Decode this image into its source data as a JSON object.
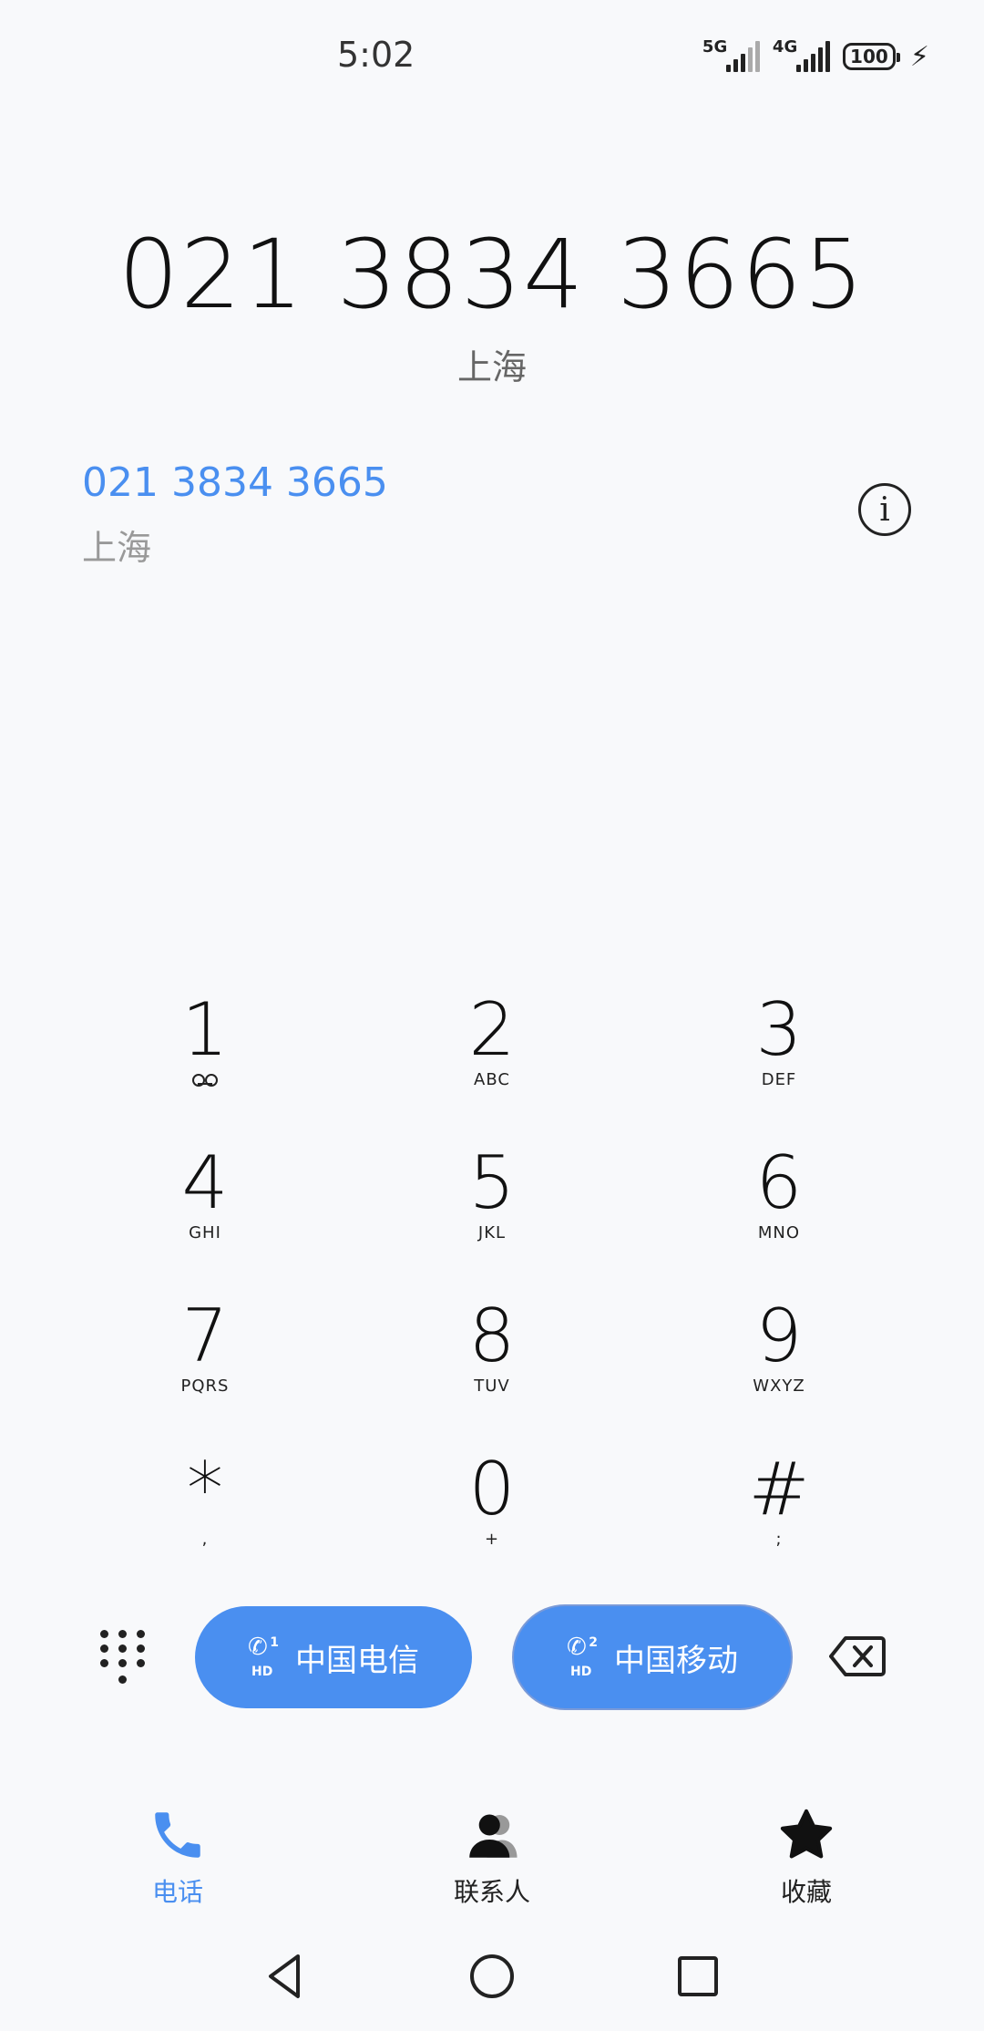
{
  "status_bar": {
    "time": "5:02",
    "sim1_network": "5G",
    "sim2_network": "4G",
    "battery_level": "100",
    "charging_icon": "bolt-icon"
  },
  "dialer": {
    "number": "021 3834 3665",
    "location": "上海"
  },
  "suggestion": {
    "number": "021 3834 3665",
    "location": "上海",
    "info_icon": "info-icon"
  },
  "keypad": {
    "keys": [
      {
        "digit": "1",
        "letters": ""
      },
      {
        "digit": "2",
        "letters": "ABC"
      },
      {
        "digit": "3",
        "letters": "DEF"
      },
      {
        "digit": "4",
        "letters": "GHI"
      },
      {
        "digit": "5",
        "letters": "JKL"
      },
      {
        "digit": "6",
        "letters": "MNO"
      },
      {
        "digit": "7",
        "letters": "PQRS"
      },
      {
        "digit": "8",
        "letters": "TUV"
      },
      {
        "digit": "9",
        "letters": "WXYZ"
      },
      {
        "digit": "*",
        "letters": ","
      },
      {
        "digit": "0",
        "letters": "+"
      },
      {
        "digit": "#",
        "letters": ";"
      }
    ]
  },
  "actions": {
    "sim1_label": "中国电信",
    "sim1_slot": "1",
    "sim2_label": "中国移动",
    "sim2_slot": "2",
    "hd_badge": "HD"
  },
  "tabs": [
    {
      "label": "电话",
      "icon": "phone-icon",
      "active": true
    },
    {
      "label": "联系人",
      "icon": "contacts-icon",
      "active": false
    },
    {
      "label": "收藏",
      "icon": "star-icon",
      "active": false
    }
  ],
  "colors": {
    "accent": "#4a8ff0",
    "background": "#f8f9fb",
    "text": "#111111"
  }
}
